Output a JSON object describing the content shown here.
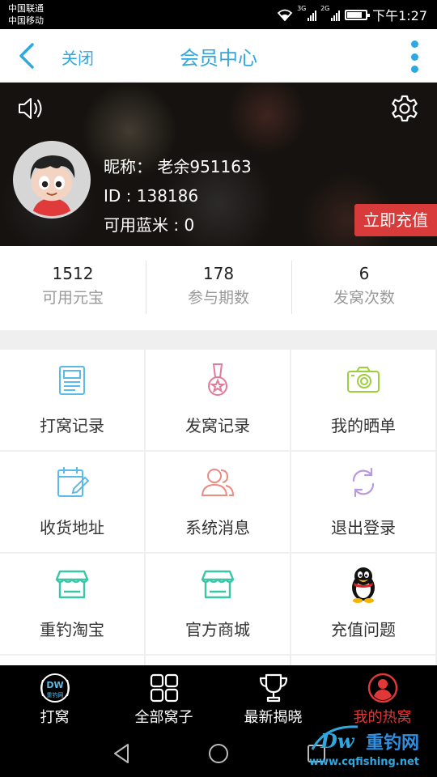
{
  "status_bar": {
    "carrier_1": "中国联通",
    "carrier_2": "中国移动",
    "network_1": "3G",
    "network_2": "2G",
    "time": "下午1:27"
  },
  "header": {
    "close_label": "关闭",
    "title": "会员中心"
  },
  "profile": {
    "nickname_label": "昵称：",
    "nickname": "老余951163",
    "id_text": "ID : 138186",
    "blue_rice_text": "可用蓝米 : 0",
    "recharge_label": "立即充值"
  },
  "stats": [
    {
      "value": "1512",
      "label": "可用元宝"
    },
    {
      "value": "178",
      "label": "参与期数"
    },
    {
      "value": "6",
      "label": "发窝次数"
    }
  ],
  "menu": [
    {
      "label": "打窝记录",
      "icon": "document-icon"
    },
    {
      "label": "发窝记录",
      "icon": "medal-icon"
    },
    {
      "label": "我的晒单",
      "icon": "camera-icon"
    },
    {
      "label": "收货地址",
      "icon": "calendar-edit-icon"
    },
    {
      "label": "系统消息",
      "icon": "users-icon"
    },
    {
      "label": "退出登录",
      "icon": "refresh-icon"
    },
    {
      "label": "重钓淘宝",
      "icon": "shop-icon"
    },
    {
      "label": "官方商城",
      "icon": "shop-icon"
    },
    {
      "label": "充值问题",
      "icon": "qq-penguin-icon"
    }
  ],
  "bottom_nav": [
    {
      "label": "打窝",
      "icon": "dw-logo-icon",
      "active": false
    },
    {
      "label": "全部窝子",
      "icon": "grid-icon",
      "active": false
    },
    {
      "label": "最新揭晓",
      "icon": "trophy-icon",
      "active": false
    },
    {
      "label": "我的热窝",
      "icon": "user-circle-icon",
      "active": true
    }
  ],
  "watermark": {
    "title": "重钓网",
    "url": "www.cqfishing.net"
  },
  "colors": {
    "accent": "#2fa8e0",
    "recharge": "#d93a3a",
    "active_nav": "#e03838",
    "icon_blue": "#5bbbe8",
    "icon_pink": "#e27a9a",
    "icon_green": "#9ccf3a",
    "icon_teal": "#39c7a8",
    "icon_salmon": "#ee8a80",
    "icon_purple": "#b79be0"
  }
}
